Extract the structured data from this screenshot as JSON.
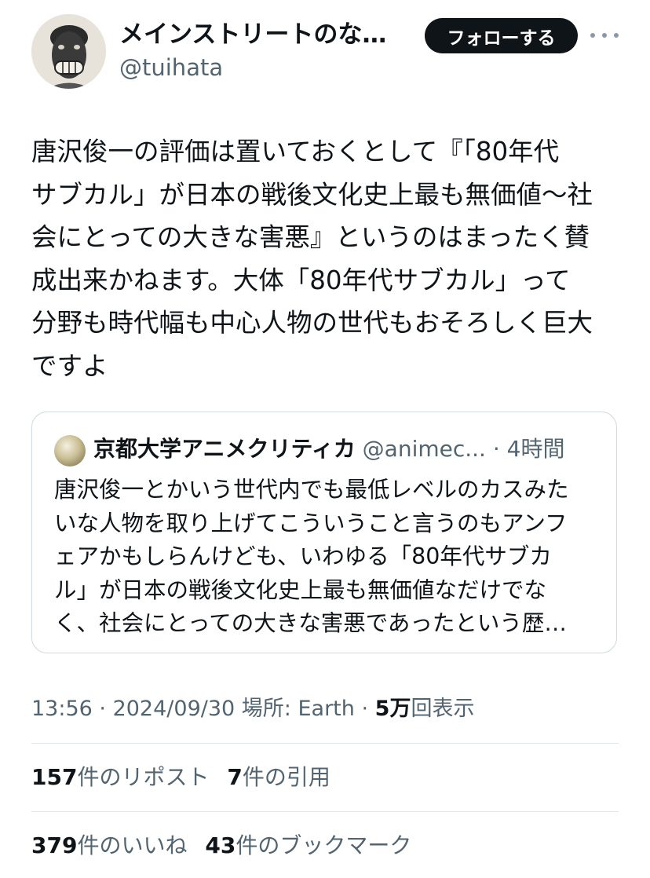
{
  "author": {
    "name": "メインストリートのなら…",
    "handle": "@tuihata"
  },
  "follow_label": "フォローする",
  "tweet_text": "唐沢俊一の評価は置いておくとして『「80年代\nサブカル」が日本の戦後文化史上最も無価値〜社\n会にとっての大きな害悪』というのはまったく賛\n成出来かねます。大体「80年代サブカル」って\n分野も時代幅も中心人物の世代もおそろしく巨大\nですよ",
  "quote": {
    "author_name": "京都大学アニメクリティカ",
    "author_handle": "@animec...",
    "time": "· 4時間",
    "text": "唐沢俊一とかいう世代内でも最低レベルのカスみた\nいな人物を取り上げてこういうこと言うのもアンフ\nェアかもしらんけども、いわゆる「80年代サブカ\nル」が日本の戦後文化史上最も無価値なだけでな\nく、社会にとっての大きな害悪であったという歴…"
  },
  "meta": {
    "time": "13:56",
    "date": "2024/09/30",
    "location": "場所: Earth",
    "views_count": "5万",
    "views_label": "回表示"
  },
  "stats": {
    "reposts_count": "157",
    "reposts_label": "件のリポスト",
    "quotes_count": "7",
    "quotes_label": "件の引用",
    "likes_count": "379",
    "likes_label": "件のいいね",
    "bookmarks_count": "43",
    "bookmarks_label": "件のブックマーク"
  },
  "colors": {
    "text": "#0f1419",
    "secondary": "#536471",
    "border": "#cfd9de",
    "button_bg": "#0f1419"
  }
}
